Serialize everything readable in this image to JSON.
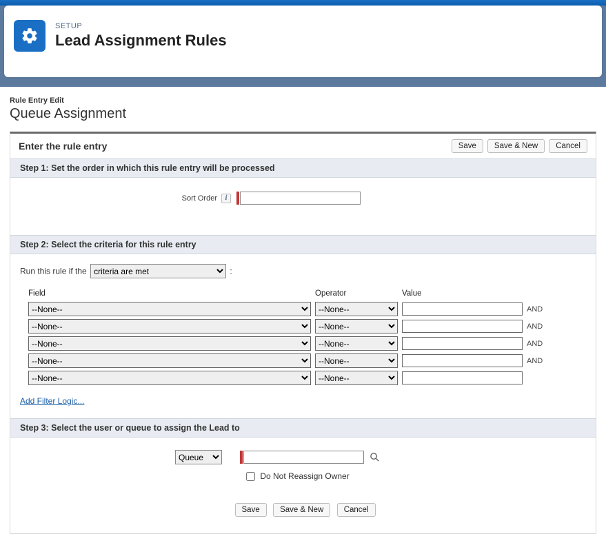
{
  "header": {
    "setup_label": "SETUP",
    "title": "Lead Assignment Rules"
  },
  "breadcrumb": "Rule Entry Edit",
  "page_title": "Queue Assignment",
  "panel_header": "Enter the rule entry",
  "buttons": {
    "save": "Save",
    "save_new": "Save & New",
    "cancel": "Cancel"
  },
  "step1": {
    "title": "Step 1: Set the order in which this rule entry will be processed",
    "sort_label": "Sort Order",
    "sort_value": ""
  },
  "step2": {
    "title": "Step 2: Select the criteria for this rule entry",
    "run_rule_label_pre": "Run this rule if the",
    "run_rule_selected": "criteria are met",
    "run_rule_suffix": ":",
    "headers": {
      "field": "Field",
      "operator": "Operator",
      "value": "Value"
    },
    "rows": [
      {
        "field": "--None--",
        "operator": "--None--",
        "value": "",
        "and": "AND"
      },
      {
        "field": "--None--",
        "operator": "--None--",
        "value": "",
        "and": "AND"
      },
      {
        "field": "--None--",
        "operator": "--None--",
        "value": "",
        "and": "AND"
      },
      {
        "field": "--None--",
        "operator": "--None--",
        "value": "",
        "and": "AND"
      },
      {
        "field": "--None--",
        "operator": "--None--",
        "value": "",
        "and": ""
      }
    ],
    "add_filter": "Add Filter Logic..."
  },
  "step3": {
    "title": "Step 3: Select the user or queue to assign the Lead to",
    "assignee_type": "Queue",
    "assignee_value": "",
    "do_not_reassign": "Do Not Reassign Owner"
  }
}
